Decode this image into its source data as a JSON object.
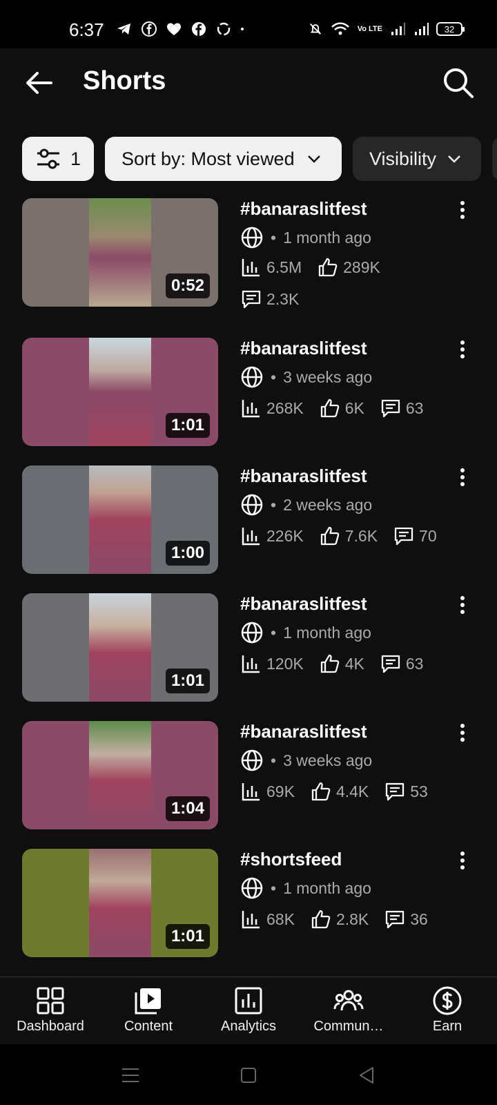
{
  "status_bar": {
    "time": "6:37",
    "battery": "32",
    "volte": "Vo LTE"
  },
  "header": {
    "title": "Shorts"
  },
  "chips": {
    "filter_count": "1",
    "sort_label": "Sort by: Most viewed",
    "visibility_label": "Visibility"
  },
  "videos": [
    {
      "title": "#banaraslitfest",
      "age": "1 month ago",
      "views": "6.5M",
      "likes": "289K",
      "comments": "2.3K",
      "duration": "0:52",
      "bg": "#7a716d",
      "center": "#6b8e4e"
    },
    {
      "title": "#banaraslitfest",
      "age": "3 weeks ago",
      "views": "268K",
      "likes": "6K",
      "comments": "63",
      "duration": "1:01",
      "bg": "#8b4a67",
      "center": "#c9d8e0"
    },
    {
      "title": "#banaraslitfest",
      "age": "2 weeks ago",
      "views": "226K",
      "likes": "7.6K",
      "comments": "70",
      "duration": "1:00",
      "bg": "#6a6d72",
      "center": "#b8bcc0"
    },
    {
      "title": "#banaraslitfest",
      "age": "1 month ago",
      "views": "120K",
      "likes": "4K",
      "comments": "63",
      "duration": "1:01",
      "bg": "#6e6e70",
      "center": "#c7d3da"
    },
    {
      "title": "#banaraslitfest",
      "age": "3 weeks ago",
      "views": "69K",
      "likes": "4.4K",
      "comments": "53",
      "duration": "1:04",
      "bg": "#8b4a67",
      "center": "#5d8a4a"
    },
    {
      "title": "#shortsfeed",
      "age": "1 month ago",
      "views": "68K",
      "likes": "2.8K",
      "comments": "36",
      "duration": "1:01",
      "bg": "#6e7a2e",
      "center": "#9a7070"
    }
  ],
  "bottom_nav": {
    "dashboard": "Dashboard",
    "content": "Content",
    "analytics": "Analytics",
    "community": "Commun…",
    "earn": "Earn"
  },
  "colors": {
    "background": "#0f0f0f",
    "chip_light": "#f1f1f1",
    "chip_dark": "#272727",
    "meta_text": "#aaaaaa"
  }
}
